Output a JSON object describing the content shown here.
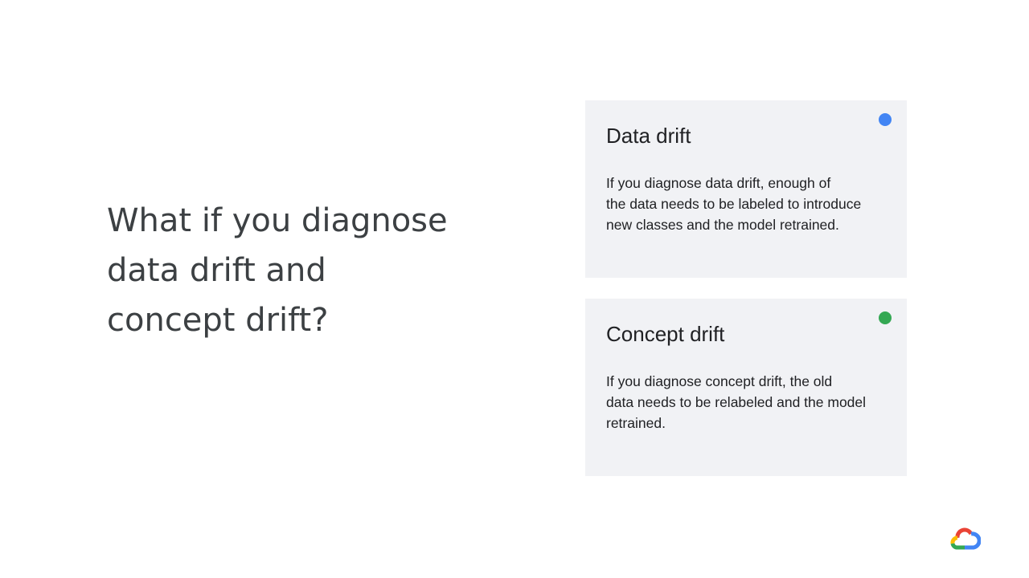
{
  "headline": {
    "lines": [
      "What if you diagnose",
      "data drift and",
      "concept drift?"
    ]
  },
  "cards": [
    {
      "title": "Data drift",
      "lines": [
        "If you diagnose data drift, enough of",
        "the data needs to be labeled to introduce",
        "new classes and the model retrained."
      ],
      "dot_color": "#4285f4"
    },
    {
      "title": "Concept drift",
      "lines": [
        "If you diagnose concept drift, the old",
        "data needs to be relabeled and the model",
        "retrained."
      ],
      "dot_color": "#34a853"
    }
  ],
  "colors": {
    "background": "#ffffff",
    "card_background": "#f1f2f5",
    "headline_text": "#3c4043",
    "card_text": "#202124",
    "logo_blue": "#4285f4",
    "logo_red": "#ea4335",
    "logo_yellow": "#fbbc04",
    "logo_green": "#34a853"
  },
  "logo": {
    "icon": "google-cloud-logo-icon"
  }
}
